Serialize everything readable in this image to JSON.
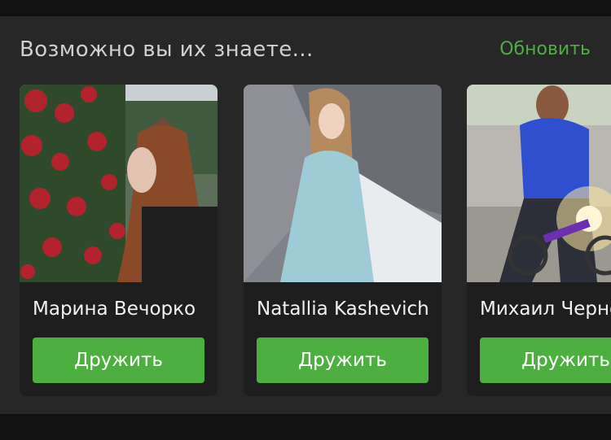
{
  "section": {
    "title": "Возможно вы их знаете...",
    "refresh_label": "Обновить"
  },
  "cards": [
    {
      "name": "Марина Вечорко",
      "button_label": "Дружить"
    },
    {
      "name": "Natallia Kashevich",
      "button_label": "Дружить"
    },
    {
      "name": "Михаил Черненко",
      "button_label": "Дружить"
    }
  ],
  "colors": {
    "accent": "#4caf3f",
    "panel_background": "#272727",
    "card_background": "#1e1e1e"
  }
}
